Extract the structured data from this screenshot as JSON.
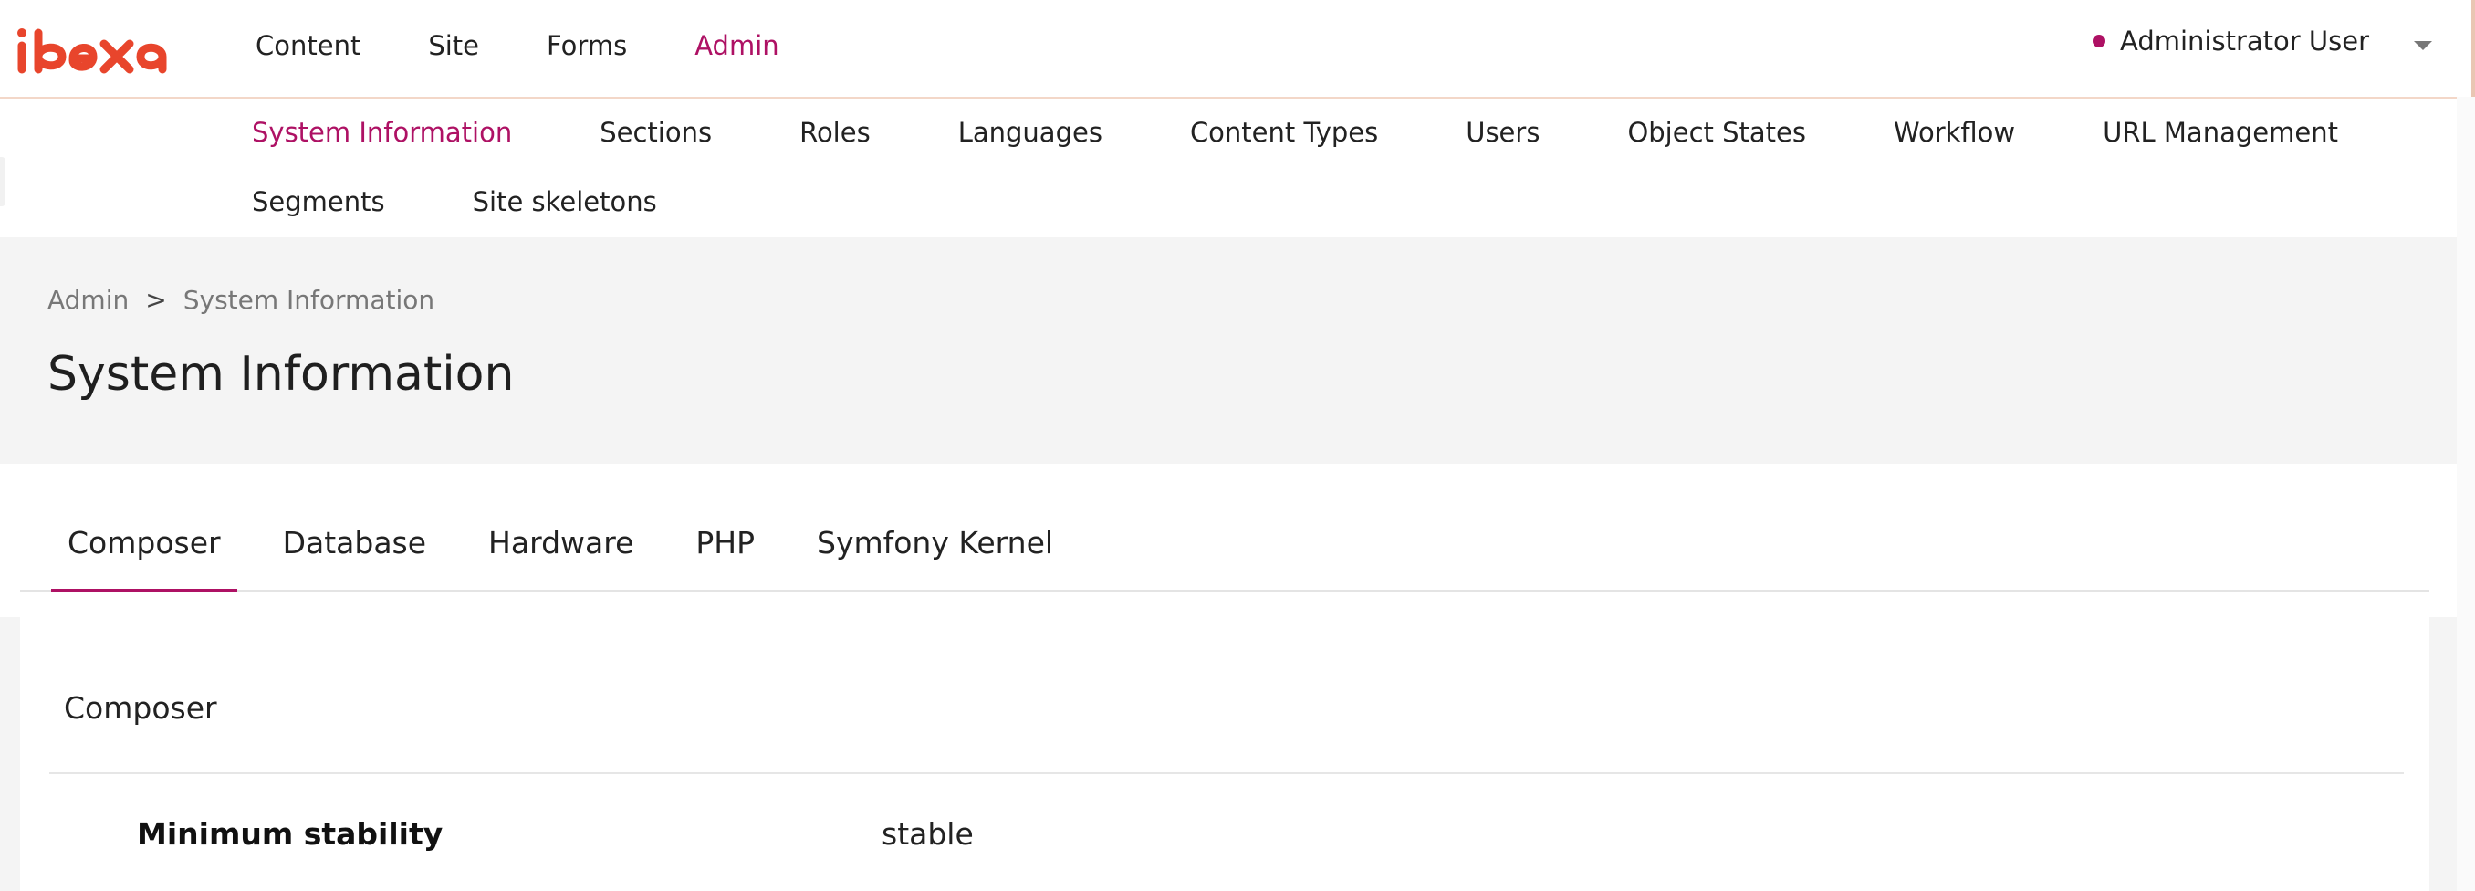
{
  "brand": {
    "logo_text": "ibexa",
    "accent_color": "#ae1164",
    "logo_color": "#e8452c"
  },
  "main_nav": [
    {
      "label": "Content",
      "active": false
    },
    {
      "label": "Site",
      "active": false
    },
    {
      "label": "Forms",
      "active": false
    },
    {
      "label": "Admin",
      "active": true
    }
  ],
  "user": {
    "name": "Administrator User",
    "status_icon": "online-dot-icon",
    "menu_icon": "chevron-down-icon"
  },
  "sub_nav": {
    "row1": [
      {
        "label": "System Information",
        "active": true
      },
      {
        "label": "Sections",
        "active": false
      },
      {
        "label": "Roles",
        "active": false
      },
      {
        "label": "Languages",
        "active": false
      },
      {
        "label": "Content Types",
        "active": false
      },
      {
        "label": "Users",
        "active": false
      },
      {
        "label": "Object States",
        "active": false
      },
      {
        "label": "Workflow",
        "active": false
      },
      {
        "label": "URL Management",
        "active": false
      }
    ],
    "row2": [
      {
        "label": "Segments",
        "active": false
      },
      {
        "label": "Site skeletons",
        "active": false
      }
    ]
  },
  "breadcrumb": {
    "items": [
      "Admin",
      "System Information"
    ],
    "separator": ">"
  },
  "page_title": "System Information",
  "tabs": [
    {
      "label": "Composer",
      "active": true
    },
    {
      "label": "Database",
      "active": false
    },
    {
      "label": "Hardware",
      "active": false
    },
    {
      "label": "PHP",
      "active": false
    },
    {
      "label": "Symfony Kernel",
      "active": false
    }
  ],
  "panel": {
    "title": "Composer",
    "rows": [
      {
        "label": "Minimum stability",
        "value": "stable"
      }
    ]
  }
}
